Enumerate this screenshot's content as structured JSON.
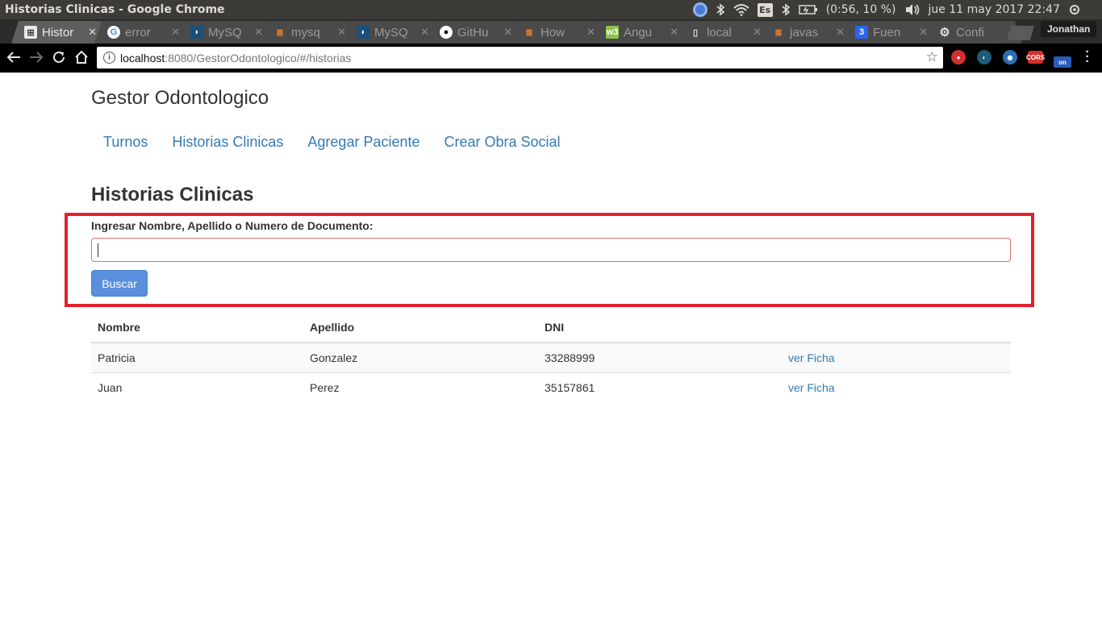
{
  "os": {
    "window_title": "Historias Clinicas - Google Chrome",
    "lang": "Es",
    "battery": "(0:56, 10 %)",
    "datetime": "jue 11 may 2017 22:47"
  },
  "browser": {
    "tabs": [
      {
        "label": "Histor",
        "icon": "document-icon",
        "active": true
      },
      {
        "label": "error",
        "icon": "google-icon"
      },
      {
        "label": "MySQ",
        "icon": "mysql-icon"
      },
      {
        "label": "mysq",
        "icon": "stackoverflow-icon"
      },
      {
        "label": "MySQ",
        "icon": "mysql-icon"
      },
      {
        "label": "GitHu",
        "icon": "github-icon"
      },
      {
        "label": "How",
        "icon": "stackoverflow-icon"
      },
      {
        "label": "Angu",
        "icon": "w3-icon"
      },
      {
        "label": "local",
        "icon": "page-icon"
      },
      {
        "label": "javas",
        "icon": "stackoverflow-icon"
      },
      {
        "label": "Fuen",
        "icon": "css3-icon"
      },
      {
        "label": "Confi",
        "icon": "gear-icon"
      }
    ],
    "profile_name": "Jonathan",
    "url_host": "localhost",
    "url_path": ":8080/GestorOdontologico/#/historias",
    "extensions": [
      "adblock-icon",
      "cast-icon",
      "globe-icon",
      "cors-icon",
      "on-icon"
    ],
    "ext_labels": {
      "cors": "CORS",
      "on": "on"
    }
  },
  "page": {
    "brand": "Gestor Odontologico",
    "nav": [
      "Turnos",
      "Historias Clinicas",
      "Agregar Paciente",
      "Crear Obra Social"
    ],
    "heading": "Historias Clinicas",
    "search": {
      "label": "Ingresar Nombre, Apellido o Numero de Documento:",
      "value": "",
      "button": "Buscar"
    },
    "table": {
      "headers": [
        "Nombre",
        "Apellido",
        "DNI",
        ""
      ],
      "rows": [
        {
          "nombre": "Patricia",
          "apellido": "Gonzalez",
          "dni": "33288999",
          "action": "ver Ficha"
        },
        {
          "nombre": "Juan",
          "apellido": "Perez",
          "dni": "35157861",
          "action": "ver Ficha"
        }
      ]
    }
  },
  "colors": {
    "link": "#337ab7",
    "highlight": "#e3202e",
    "button": "#5a8fdd"
  }
}
